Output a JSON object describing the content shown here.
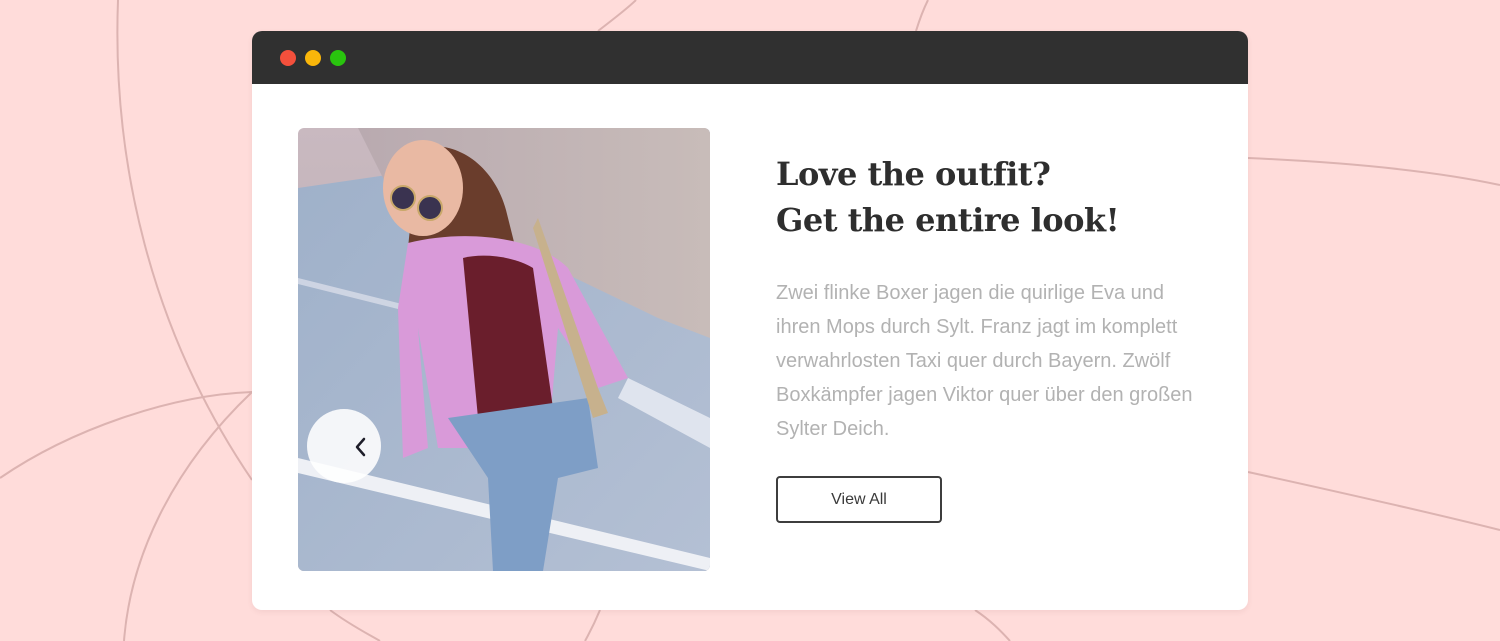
{
  "window": {
    "titlebar_color": "#303030",
    "controls": [
      "close",
      "minimize",
      "maximize"
    ],
    "control_colors": [
      "#f4503c",
      "#f9b60a",
      "#29c40e"
    ]
  },
  "carousel": {
    "prev_icon": "chevron-left-icon",
    "next_icon": "chevron-right-icon"
  },
  "content": {
    "heading_line1": "Love the outfit?",
    "heading_line2": "Get the entire look!",
    "description": "Zwei flinke Boxer jagen die quirlige Eva und ihren Mops durch Sylt. Franz jagt im komplett verwahrlosten Taxi quer durch Bayern. Zwölf Boxkämpfer jagen Viktor quer über den großen Sylter Deich.",
    "button_label": "View All"
  },
  "colors": {
    "page_background": "#ffdcda",
    "heading": "#2e2e2e",
    "body_text": "#b2b2b2"
  }
}
